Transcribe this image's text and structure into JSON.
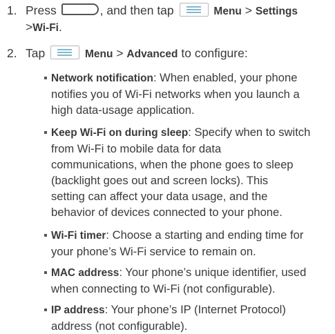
{
  "steps": [
    {
      "number": "1.",
      "t_press": "Press",
      "t_then": ", and then tap",
      "menu": "Menu",
      "sep": ">",
      "settings": "Settings",
      "wifi": "Wi-Fi",
      "end": "."
    },
    {
      "number": "2.",
      "t_tap": "Tap",
      "menu": "Menu",
      "sep": ">",
      "advanced": "Advanced",
      "t_rest": "to configure:"
    }
  ],
  "bullets": [
    {
      "term": "Network notification",
      "lines": [
        ": When enabled, your phone",
        "notifies you of Wi-Fi networks when you launch a",
        "high data-usage application."
      ]
    },
    {
      "term": "Keep Wi-Fi on during sleep",
      "lines": [
        ": Specify when to switch",
        "from Wi-Fi to mobile data for data",
        "communications, when the phone goes to sleep",
        "(backlight goes out and screen locks). This",
        "setting can affect your data usage, and the",
        "behavior of devices connected to your phone."
      ]
    },
    {
      "term": "Wi-Fi timer",
      "lines": [
        ": Choose a starting and ending time for",
        "your phone’s Wi-Fi service to remain on."
      ]
    },
    {
      "term": "MAC address",
      "lines": [
        ": Your phone’s unique identifier, used",
        "when connecting to Wi-Fi (not configurable)."
      ]
    },
    {
      "term": "IP address",
      "lines": [
        ": Your phone’s IP (Internet Protocol)",
        "address (not configurable)."
      ]
    }
  ],
  "icons": {
    "home_key": "home-key-icon",
    "menu_key": "menu-key-icon"
  },
  "colors": {
    "text": "#3a3a3a",
    "menu_icon_lines": "#7fb9cf"
  }
}
